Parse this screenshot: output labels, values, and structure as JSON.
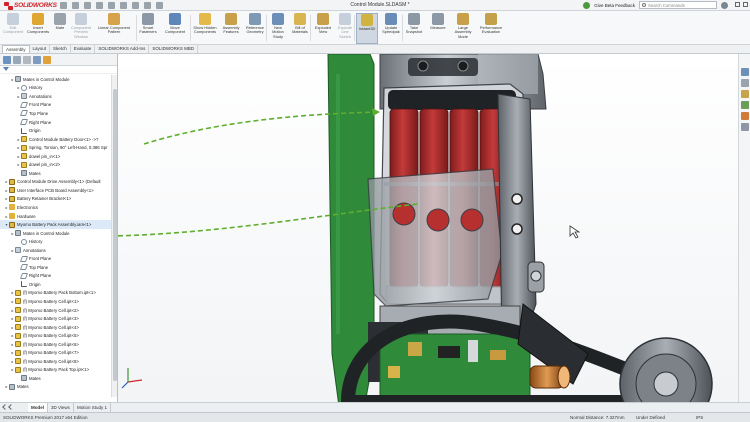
{
  "app": {
    "logo": "SOLIDWORKS",
    "document_title": "Control Module.SLDASM *",
    "feedback_label": "Give Beta Feedback",
    "search_placeholder": "Search Commands"
  },
  "ribbon": [
    {
      "label": "Edit Component",
      "state": "dim",
      "icon": "edit-component-icon",
      "color": "#8aa0b8"
    },
    {
      "label": "Insert Components",
      "state": "normal",
      "icon": "insert-components-icon",
      "color": "#e0a632"
    },
    {
      "label": "Mate",
      "state": "normal",
      "icon": "mate-icon",
      "color": "#9aa3ab"
    },
    {
      "label": "Component Preview Window",
      "state": "dim",
      "icon": "preview-window-icon",
      "color": "#8aa0b8"
    },
    {
      "label": "Linear Component Pattern",
      "state": "normal",
      "icon": "linear-pattern-icon",
      "color": "#d6a34a"
    },
    {
      "label": "Smart Fasteners",
      "state": "normal",
      "icon": "smart-fasteners-icon",
      "color": "#8c98a6"
    },
    {
      "label": "Move Component",
      "state": "normal",
      "icon": "move-component-icon",
      "color": "#5f86b8"
    },
    {
      "label": "Show Hidden Components",
      "state": "normal",
      "icon": "show-hidden-icon",
      "color": "#e4b84a"
    },
    {
      "label": "Assembly Features",
      "state": "normal",
      "icon": "assembly-features-icon",
      "color": "#c9a04a"
    },
    {
      "label": "Reference Geometry",
      "state": "normal",
      "icon": "reference-geometry-icon",
      "color": "#7f98b4"
    },
    {
      "label": "New Motion Study",
      "state": "normal",
      "icon": "motion-study-icon",
      "color": "#6b8fb9"
    },
    {
      "label": "Bill of Materials",
      "state": "normal",
      "icon": "bom-icon",
      "color": "#d9b550"
    },
    {
      "label": "Exploded View",
      "state": "normal",
      "icon": "exploded-view-icon",
      "color": "#c9a04a"
    },
    {
      "label": "Explode Line Sketch",
      "state": "dim",
      "icon": "explode-line-icon",
      "color": "#8aa0b8"
    },
    {
      "label": "Instant3D",
      "state": "active",
      "icon": "instant3d-icon",
      "color": "#d0b340"
    },
    {
      "label": "Update Speedpak",
      "state": "normal",
      "icon": "speedpak-icon",
      "color": "#6a8db8"
    },
    {
      "label": "Take Snapshot",
      "state": "normal",
      "icon": "snapshot-icon",
      "color": "#8c98a6"
    },
    {
      "label": "Measure",
      "state": "normal",
      "icon": "measure-icon",
      "color": "#8c98a6"
    },
    {
      "label": "Large Assembly Mode",
      "state": "normal",
      "icon": "large-assembly-icon",
      "color": "#c9a04a"
    },
    {
      "label": "Performance Evaluation",
      "state": "normal",
      "icon": "performance-icon",
      "color": "#c4a04a"
    }
  ],
  "tabs": [
    "Assembly",
    "Layout",
    "Sketch",
    "Evaluate",
    "SOLIDWORKS Add-Ins",
    "SOLIDWORKS MBD"
  ],
  "tree": [
    {
      "indent": 1,
      "exp": "▸",
      "icon": "k-mate",
      "iname": "mates-icon",
      "label": "Mates in Control Module"
    },
    {
      "indent": 2,
      "exp": "▸",
      "icon": "k-history",
      "iname": "history-icon",
      "label": "History"
    },
    {
      "indent": 2,
      "exp": "▸",
      "icon": "k-annot",
      "iname": "annotations-icon",
      "label": "Annotations"
    },
    {
      "indent": 2,
      "exp": "",
      "icon": "k-plane",
      "iname": "plane-icon",
      "label": "Front Plane"
    },
    {
      "indent": 2,
      "exp": "",
      "icon": "k-plane",
      "iname": "plane-icon",
      "label": "Top Plane"
    },
    {
      "indent": 2,
      "exp": "",
      "icon": "k-plane",
      "iname": "plane-icon",
      "label": "Right Plane"
    },
    {
      "indent": 2,
      "exp": "",
      "icon": "k-origin",
      "iname": "origin-icon",
      "label": "Origin"
    },
    {
      "indent": 2,
      "exp": "▸",
      "icon": "k-part",
      "iname": "part-icon",
      "label": "Control Module Battery Door<1> ->?"
    },
    {
      "indent": 2,
      "exp": "▸",
      "icon": "k-part",
      "iname": "part-icon",
      "label": "Spring, Torsion, 90° Left-Hand, 0.386 Spr"
    },
    {
      "indent": 2,
      "exp": "▸",
      "icon": "k-part",
      "iname": "part-icon",
      "label": "dowel pin_in<1>"
    },
    {
      "indent": 2,
      "exp": "▸",
      "icon": "k-part",
      "iname": "part-icon",
      "label": "dowel pin_in<2>"
    },
    {
      "indent": 2,
      "exp": "",
      "icon": "k-mate",
      "iname": "mates-icon",
      "label": "Mates"
    },
    {
      "indent": 0,
      "exp": "▸",
      "icon": "k-asm",
      "iname": "assembly-icon",
      "label": "Control Module Drive Assembly<1> (Default"
    },
    {
      "indent": 0,
      "exp": "▸",
      "icon": "k-asm",
      "iname": "assembly-icon",
      "label": "User Interface PCB Board Assembly<1>"
    },
    {
      "indent": 0,
      "exp": "▸",
      "icon": "k-asm",
      "iname": "assembly-icon",
      "label": "Battery Retainer Bracket<1>"
    },
    {
      "indent": 0,
      "exp": "▸",
      "icon": "k-folder",
      "iname": "folder-icon",
      "label": "Electronics"
    },
    {
      "indent": 0,
      "exp": "▸",
      "icon": "k-folder",
      "iname": "folder-icon",
      "label": "Hardware"
    },
    {
      "indent": 0,
      "exp": "▾",
      "icon": "k-asm",
      "iname": "assembly-icon",
      "label": "Myomo Battery Pack Assembly.iam<1>",
      "hl": true
    },
    {
      "indent": 1,
      "exp": "▸",
      "icon": "k-mate",
      "iname": "mates-icon",
      "label": "Mates in Control Module"
    },
    {
      "indent": 2,
      "exp": "",
      "icon": "k-history",
      "iname": "history-icon",
      "label": "History"
    },
    {
      "indent": 1,
      "exp": "▸",
      "icon": "k-annot",
      "iname": "annotations-icon",
      "label": "Annotations"
    },
    {
      "indent": 2,
      "exp": "",
      "icon": "k-plane",
      "iname": "plane-icon",
      "label": "Front Plane"
    },
    {
      "indent": 2,
      "exp": "",
      "icon": "k-plane",
      "iname": "plane-icon",
      "label": "Top Plane"
    },
    {
      "indent": 2,
      "exp": "",
      "icon": "k-plane",
      "iname": "plane-icon",
      "label": "Right Plane"
    },
    {
      "indent": 2,
      "exp": "",
      "icon": "k-origin",
      "iname": "origin-icon",
      "label": "Origin"
    },
    {
      "indent": 1,
      "exp": "▸",
      "icon": "k-part",
      "iname": "part-icon",
      "label": "(f) Myomo Battery Pack Bottom.ipt<1>"
    },
    {
      "indent": 1,
      "exp": "▸",
      "icon": "k-part",
      "iname": "part-icon",
      "label": "(f) Myomo Battery Cell.ipt<1>"
    },
    {
      "indent": 1,
      "exp": "▸",
      "icon": "k-part",
      "iname": "part-icon",
      "label": "(f) Myomo Battery Cell.ipt<2>"
    },
    {
      "indent": 1,
      "exp": "▸",
      "icon": "k-part",
      "iname": "part-icon",
      "label": "(f) Myomo Battery Cell.ipt<3>"
    },
    {
      "indent": 1,
      "exp": "▸",
      "icon": "k-part",
      "iname": "part-icon",
      "label": "(f) Myomo Battery Cell.ipt<4>"
    },
    {
      "indent": 1,
      "exp": "▸",
      "icon": "k-part",
      "iname": "part-icon",
      "label": "(f) Myomo Battery Cell.ipt<5>"
    },
    {
      "indent": 1,
      "exp": "▸",
      "icon": "k-part",
      "iname": "part-icon",
      "label": "(f) Myomo Battery Cell.ipt<6>"
    },
    {
      "indent": 1,
      "exp": "▸",
      "icon": "k-part",
      "iname": "part-icon",
      "label": "(f) Myomo Battery Cell.ipt<7>"
    },
    {
      "indent": 1,
      "exp": "▸",
      "icon": "k-part",
      "iname": "part-icon",
      "label": "(f) Myomo Battery Cell.ipt<8>"
    },
    {
      "indent": 1,
      "exp": "▸",
      "icon": "k-part",
      "iname": "part-icon",
      "label": "(f) Myomo Battery Pack Top.ipt<1>"
    },
    {
      "indent": 2,
      "exp": "",
      "icon": "k-mate",
      "iname": "mates-icon",
      "label": "Mates"
    },
    {
      "indent": 0,
      "exp": "▸",
      "icon": "k-mate",
      "iname": "mates-icon",
      "label": "Mates"
    }
  ],
  "bottom_tabs": [
    "Model",
    "3D Views",
    "Motion Study 1"
  ],
  "status": {
    "edition": "SOLIDWORKS Premium 2017 x64 Edition",
    "distance": "Normal Distance: 7.327mm",
    "state": "Under Defined",
    "units": "IPS"
  },
  "colors": {
    "accent": "#d0232a",
    "battery_red": "#b42a2a",
    "pcb_green": "#2f8a3a",
    "arrow_green": "#5fae2e",
    "selection_blue": "#dbe9f9"
  }
}
